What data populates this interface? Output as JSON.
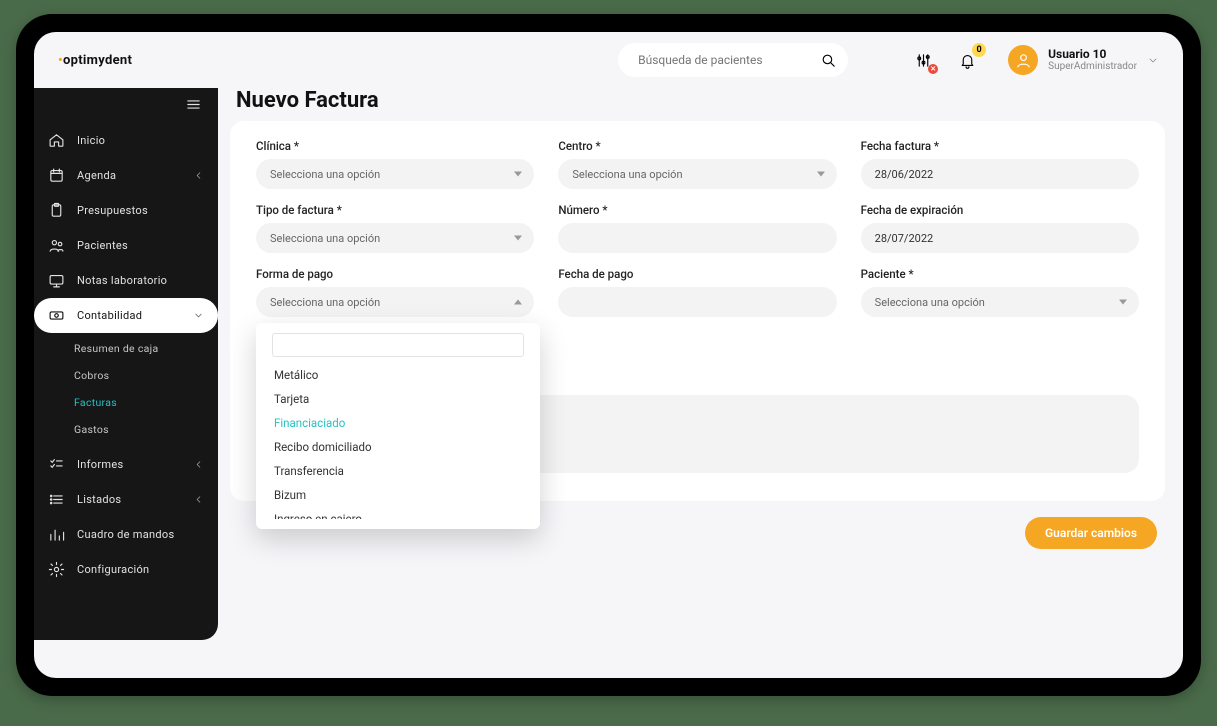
{
  "brand": "optimydent",
  "search": {
    "placeholder": "Búsqueda de pacientes"
  },
  "notifications": {
    "count": "0"
  },
  "user": {
    "name": "Usuario 10",
    "role": "SuperAdministrador"
  },
  "sidebar": {
    "items": [
      {
        "label": "Inicio"
      },
      {
        "label": "Agenda"
      },
      {
        "label": "Presupuestos"
      },
      {
        "label": "Pacientes"
      },
      {
        "label": "Notas laboratorio"
      },
      {
        "label": "Contabilidad"
      },
      {
        "label": "Informes"
      },
      {
        "label": "Listados"
      },
      {
        "label": "Cuadro de mandos"
      },
      {
        "label": "Configuración"
      }
    ],
    "sub": [
      {
        "label": "Resumen de caja"
      },
      {
        "label": "Cobros"
      },
      {
        "label": "Facturas"
      },
      {
        "label": "Gastos"
      }
    ]
  },
  "page": {
    "title": "Nuevo Factura"
  },
  "form": {
    "clinica": {
      "label": "Clínica *",
      "value": "Selecciona una opción"
    },
    "centro": {
      "label": "Centro *",
      "value": "Selecciona una opción"
    },
    "fecha_factura": {
      "label": "Fecha factura *",
      "value": "28/06/2022"
    },
    "tipo_factura": {
      "label": "Tipo de factura *",
      "value": "Selecciona una opción"
    },
    "numero": {
      "label": "Número *",
      "value": ""
    },
    "fecha_exp": {
      "label": "Fecha de expiración",
      "value": "28/07/2022"
    },
    "forma_pago": {
      "label": "Forma de pago",
      "value": "Selecciona una opción",
      "options": [
        "Metálico",
        "Tarjeta",
        "Financiaciado",
        "Recibo domiciliado",
        "Transferencia",
        "Bizum",
        "Ingreso en cajero"
      ],
      "highlight_index": 2
    },
    "fecha_pago": {
      "label": "Fecha de pago",
      "value": ""
    },
    "paciente": {
      "label": "Paciente *",
      "value": "Selecciona una opción"
    }
  },
  "actions": {
    "save": "Guardar cambios"
  }
}
